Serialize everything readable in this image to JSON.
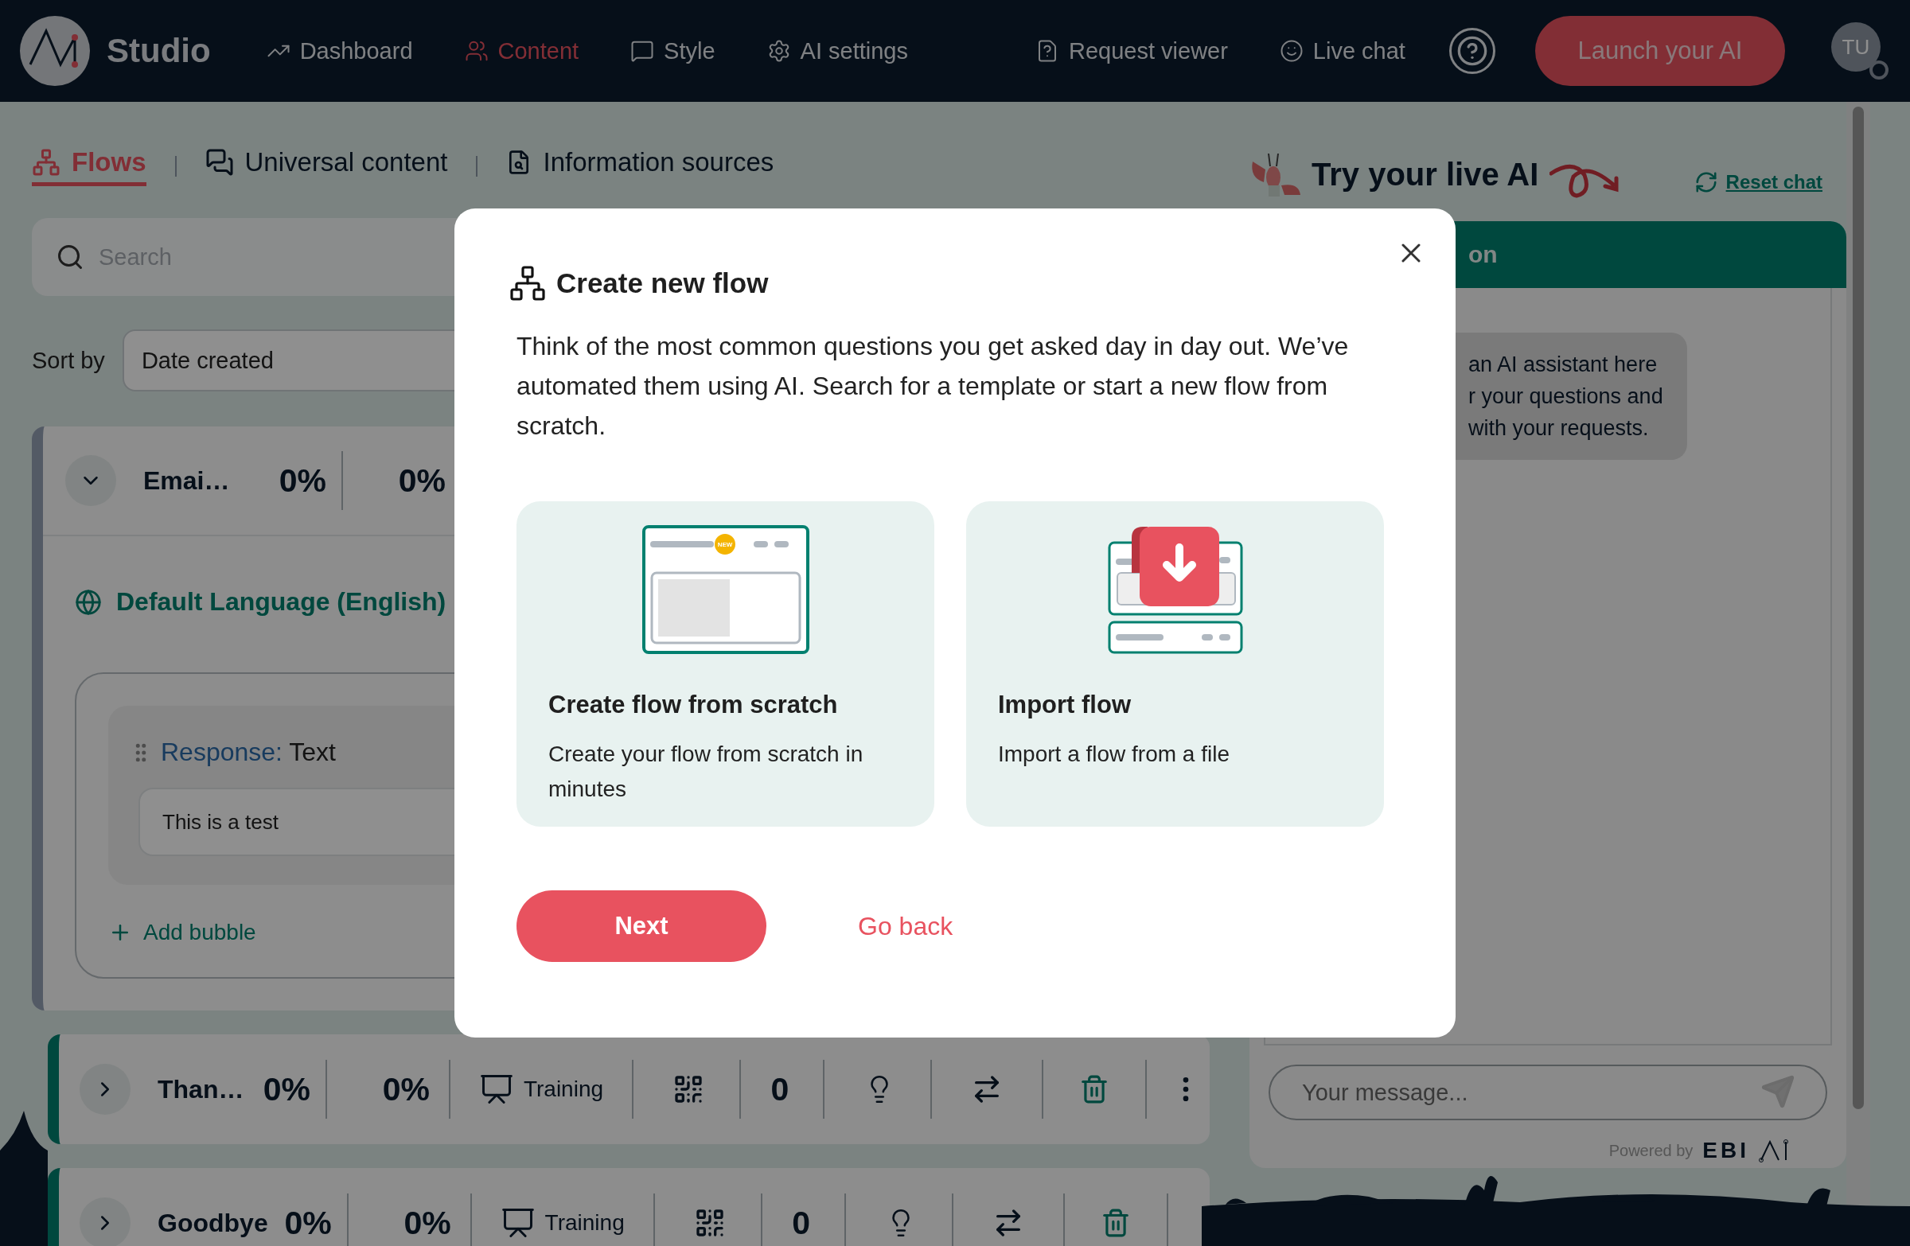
{
  "nav": {
    "brand": "Studio",
    "items": [
      {
        "label": "Dashboard",
        "kind": "dashboard",
        "selected": false
      },
      {
        "label": "Content",
        "kind": "content",
        "selected": true
      },
      {
        "label": "Style",
        "kind": "style",
        "selected": false
      },
      {
        "label": "AI settings",
        "kind": "settings",
        "selected": false
      },
      {
        "label": "Request viewer",
        "kind": "requests",
        "selected": false
      },
      {
        "label": "Live chat",
        "kind": "livechat",
        "selected": false
      }
    ],
    "launch_button": "Launch your AI",
    "avatar": "TU"
  },
  "tabs": [
    {
      "label": "Flows",
      "kind": "flows",
      "selected": true
    },
    {
      "label": "Universal content",
      "kind": "universal",
      "selected": false
    },
    {
      "label": "Information sources",
      "kind": "sources",
      "selected": false
    }
  ],
  "search": {
    "placeholder": "Search"
  },
  "sort": {
    "label": "Sort by",
    "value": "Date created"
  },
  "flows": [
    {
      "name": "Emai…",
      "expanded": true,
      "stat_1": "0%",
      "stat_2": "0%",
      "language": "Default Language (English)",
      "bubble": {
        "label": "Response:",
        "type": "Text",
        "value": "This is a test"
      },
      "add_bubble": "Add bubble"
    },
    {
      "name": "Than…",
      "expanded": false,
      "stat_1": "0%",
      "stat_2": "0%",
      "training": "Training",
      "count": "0"
    },
    {
      "name": "Goodbye",
      "expanded": false,
      "stat_1": "0%",
      "stat_2": "0%",
      "training": "Training",
      "count": "0"
    }
  ],
  "try_panel": {
    "title": "Try your live AI",
    "reset": "Reset chat"
  },
  "chat": {
    "header": "on",
    "message_lines": [
      "an AI assistant here",
      "r your questions and",
      "with your requests."
    ],
    "input": {
      "placeholder": "Your message..."
    },
    "powered_by": "Powered by",
    "logo": "EBI"
  },
  "modal": {
    "title": "Create new flow",
    "description": "Think of the most common questions you get asked day in day out. We’ve automated them using AI. Search for a template or start a new flow from scratch.",
    "options": [
      {
        "kind": "scratch",
        "title": "Create flow from scratch",
        "description": "Create your flow from scratch in minutes",
        "badge": "NEW"
      },
      {
        "kind": "import",
        "title": "Import flow",
        "description": "Import a flow from a file"
      }
    ],
    "next": "Next",
    "back": "Go back"
  }
}
